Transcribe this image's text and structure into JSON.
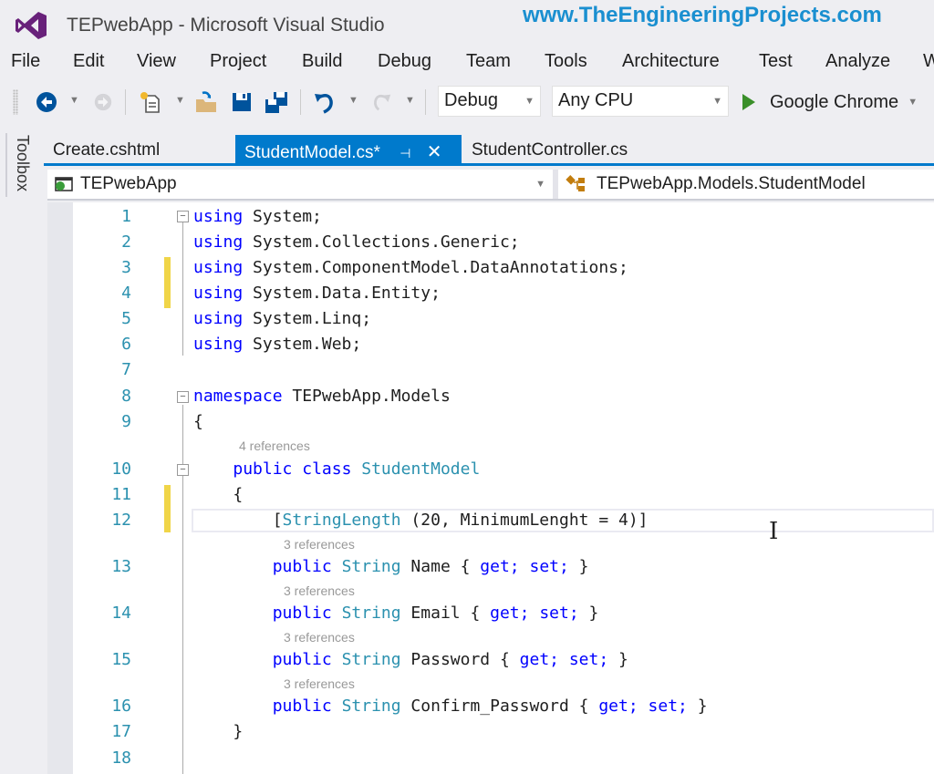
{
  "window": {
    "title": "TEPwebApp - Microsoft Visual Studio",
    "watermark": "www.TheEngineeringProjects.com",
    "logo_icon": "visual-studio-logo-icon"
  },
  "menu": [
    "File",
    "Edit",
    "View",
    "Project",
    "Build",
    "Debug",
    "Team",
    "Tools",
    "Architecture",
    "Test",
    "Analyze",
    "W"
  ],
  "toolbar": {
    "icons": [
      "back-icon",
      "forward-icon",
      "new-project-icon",
      "open-file-icon",
      "save-icon",
      "save-all-icon",
      "undo-icon",
      "redo-icon"
    ],
    "configuration": "Debug",
    "platform": "Any CPU",
    "run_target": "Google Chrome"
  },
  "toolbox": {
    "label": "Toolbox"
  },
  "tabs": [
    {
      "label": "Create.cshtml",
      "active": false
    },
    {
      "label": "StudentModel.cs*",
      "active": true,
      "pin": "⊣",
      "close": "✕"
    },
    {
      "label": "StudentController.cs",
      "active": false
    }
  ],
  "navbar": {
    "project": "TEPwebApp",
    "type": "TEPwebApp.Models.StudentModel"
  },
  "editor": {
    "references": {
      "class": "4 references",
      "name": "3 references",
      "email": "3 references",
      "password": "3 references",
      "confirm": "3 references"
    },
    "lines": [
      {
        "n": "1",
        "tokens": [
          [
            "kw",
            "using"
          ],
          [
            "",
            "System;"
          ]
        ]
      },
      {
        "n": "2",
        "tokens": [
          [
            "kw",
            "using"
          ],
          [
            "",
            "System.Collections.Generic;"
          ]
        ]
      },
      {
        "n": "3",
        "tokens": [
          [
            "kw",
            "using"
          ],
          [
            "",
            "System.ComponentModel.DataAnnotations;"
          ]
        ]
      },
      {
        "n": "4",
        "tokens": [
          [
            "kw",
            "using"
          ],
          [
            "",
            "System.Data.Entity;"
          ]
        ]
      },
      {
        "n": "5",
        "tokens": [
          [
            "kw",
            "using"
          ],
          [
            "",
            "System.Linq;"
          ]
        ]
      },
      {
        "n": "6",
        "tokens": [
          [
            "kw",
            "using"
          ],
          [
            "",
            "System.Web;"
          ]
        ]
      },
      {
        "n": "7",
        "tokens": []
      },
      {
        "n": "8",
        "tokens": [
          [
            "kw",
            "namespace"
          ],
          [
            "",
            "TEPwebApp.Models"
          ]
        ]
      },
      {
        "n": "9",
        "tokens": [
          [
            "",
            "{"
          ]
        ]
      },
      {
        "n": "10",
        "tokens": [
          [
            "",
            "    "
          ],
          [
            "kw",
            "public"
          ],
          [
            "kw",
            "class"
          ],
          [
            "ty",
            "StudentModel"
          ]
        ]
      },
      {
        "n": "11",
        "tokens": [
          [
            "",
            "    {"
          ]
        ]
      },
      {
        "n": "12",
        "tokens": [
          [
            "",
            "        ["
          ],
          [
            "ty",
            "StringLength"
          ],
          [
            "",
            "(20, MinimumLenght = 4)]"
          ]
        ]
      },
      {
        "n": "13",
        "tokens": [
          [
            "",
            "        "
          ],
          [
            "kw",
            "public"
          ],
          [
            "ty",
            " String"
          ],
          [
            "",
            "Name {"
          ],
          [
            "kw",
            "get;"
          ],
          [
            "kw",
            "set;"
          ],
          [
            "",
            "}"
          ]
        ]
      },
      {
        "n": "14",
        "tokens": [
          [
            "",
            "        "
          ],
          [
            "kw",
            "public"
          ],
          [
            "ty",
            " String"
          ],
          [
            "",
            "Email {"
          ],
          [
            "kw",
            "get;"
          ],
          [
            "kw",
            "set;"
          ],
          [
            "",
            "}"
          ]
        ]
      },
      {
        "n": "15",
        "tokens": [
          [
            "",
            "        "
          ],
          [
            "kw",
            "public"
          ],
          [
            "ty",
            "String"
          ],
          [
            "",
            "Password {"
          ],
          [
            "kw",
            "get;"
          ],
          [
            "kw",
            "set;"
          ],
          [
            "",
            "}"
          ]
        ]
      },
      {
        "n": "16",
        "tokens": [
          [
            "",
            "        "
          ],
          [
            "kw",
            "public"
          ],
          [
            "ty",
            "String"
          ],
          [
            "",
            "Confirm_Password {"
          ],
          [
            "kw",
            "get;"
          ],
          [
            "kw",
            "set;"
          ],
          [
            "",
            "}"
          ]
        ]
      },
      {
        "n": "17",
        "tokens": [
          [
            "",
            "    }"
          ]
        ]
      },
      {
        "n": "18",
        "tokens": []
      }
    ]
  }
}
